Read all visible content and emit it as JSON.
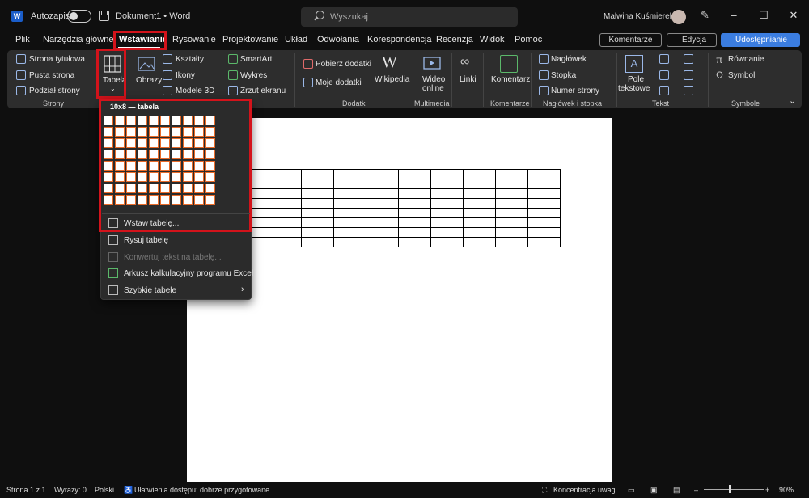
{
  "titlebar": {
    "app_icon": "word-logo",
    "autosave_label": "Autozapis",
    "doc_title": "Dokument1 • Word",
    "search_placeholder": "Wyszukaj",
    "user_name": "Malwina Kuśmierek"
  },
  "menu": {
    "items": [
      "Plik",
      "Narzędzia główne",
      "Wstawianie",
      "Rysowanie",
      "Projektowanie",
      "Układ",
      "Odwołania",
      "Korespondencja",
      "Recenzja",
      "Widok",
      "Pomoc"
    ],
    "active": "Wstawianie",
    "comments_label": "Komentarze",
    "edit_label": "Edycja",
    "share_label": "Udostępnianie"
  },
  "ribbon": {
    "pages": {
      "title_page": "Strona tytułowa",
      "blank_page": "Pusta strona",
      "page_break": "Podział strony",
      "group": "Strony"
    },
    "table": {
      "label": "Tabela"
    },
    "illustrations": {
      "pictures": "Obrazy",
      "shapes": "Kształty",
      "icons": "Ikony",
      "models3d": "Modele 3D",
      "smartart": "SmartArt",
      "chart": "Wykres",
      "screenshot": "Zrzut ekranu"
    },
    "addins": {
      "get": "Pobierz dodatki",
      "my": "Moje dodatki",
      "wikipedia": "Wikipedia",
      "group": "Dodatki"
    },
    "media": {
      "online_video_1": "Wideo",
      "online_video_2": "online",
      "group": "Multimedia"
    },
    "links": {
      "label": "Linki"
    },
    "comments": {
      "label": "Komentarz",
      "group": "Komentarze"
    },
    "header_footer": {
      "header": "Nagłówek",
      "footer": "Stopka",
      "page_number": "Numer strony",
      "group": "Nagłówek i stopka"
    },
    "text": {
      "textbox_1": "Pole",
      "textbox_2": "tekstowe",
      "group": "Tekst"
    },
    "symbols": {
      "equation": "Równanie",
      "symbol": "Symbol",
      "group": "Symbole"
    }
  },
  "dropdown": {
    "title": "10x8 — tabela",
    "grid_cols": 10,
    "grid_rows": 8,
    "selected_cols": 10,
    "selected_rows": 8,
    "items": [
      {
        "label": "Wstaw tabelę...",
        "enabled": true
      },
      {
        "label": "Rysuj tabelę",
        "enabled": true
      },
      {
        "label": "Konwertuj tekst na tabelę...",
        "enabled": false
      },
      {
        "label": "Arkusz kalkulacyjny programu Excel",
        "enabled": true
      },
      {
        "label": "Szybkie tabele",
        "enabled": true
      }
    ]
  },
  "document": {
    "table_rows": 8,
    "table_cols": 10
  },
  "status": {
    "page": "Strona 1 z 1",
    "words": "Wyrazy: 0",
    "language": "Polski",
    "accessibility": "Ułatwienia dostępu: dobrze przygotowane",
    "focus": "Koncentracja uwagi",
    "zoom": "90%"
  },
  "colors": {
    "highlight": "#d3131b",
    "accent": "#3b7de0",
    "grid_selected_border": "#e86b2a"
  }
}
